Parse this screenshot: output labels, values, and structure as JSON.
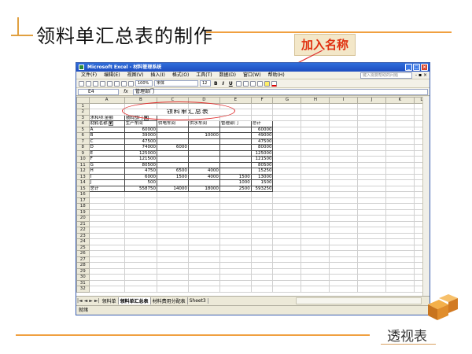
{
  "slide": {
    "title": "领料单汇总表的制作",
    "callout": "加入名称",
    "footer_label": "透视表",
    "accent_color": "#f0a040",
    "callout_text_color": "#e03010"
  },
  "excel": {
    "window_title": "Microsoft Excel - 材料管理系统",
    "menu": [
      "文件(F)",
      "编辑(E)",
      "视图(V)",
      "插入(I)",
      "格式(O)",
      "工具(T)",
      "数据(D)",
      "窗口(W)",
      "帮助(H)"
    ],
    "help_placeholder": "键入需要帮助的问题",
    "toolbar": {
      "zoom": "100%",
      "font": "宋体",
      "font_size": "12",
      "bold": "B",
      "italic": "I",
      "underline": "U"
    },
    "name_box": "E4",
    "fx": "fx",
    "formula": "管理部门",
    "columns": [
      "A",
      "B",
      "C",
      "D",
      "E",
      "F",
      "G",
      "H",
      "I",
      "J",
      "K",
      "L"
    ],
    "pivot": {
      "title": "领料单汇总表",
      "sum_label": "求和项:金额",
      "page_field": "领料部门",
      "header": [
        "材料名称",
        "生产车间",
        "供电车间",
        "供水车间",
        "管理部门",
        "总计"
      ],
      "rows": [
        [
          "A",
          "60000",
          "",
          "",
          "",
          "60000"
        ],
        [
          "B",
          "39000",
          "",
          "10000",
          "",
          "49000"
        ],
        [
          "C",
          "47500",
          "",
          "",
          "",
          "47500"
        ],
        [
          "D",
          "74000",
          "6000",
          "",
          "",
          "80000"
        ],
        [
          "E",
          "125000",
          "",
          "",
          "",
          "125000"
        ],
        [
          "F",
          "121500",
          "",
          "",
          "",
          "121500"
        ],
        [
          "G",
          "80500",
          "",
          "",
          "",
          "80500"
        ],
        [
          "H",
          "4750",
          "6500",
          "4000",
          "",
          "15250"
        ],
        [
          "I",
          "6000",
          "1500",
          "4000",
          "1500",
          "13000"
        ],
        [
          "J",
          "500",
          "",
          "",
          "1000",
          "1500"
        ],
        [
          "总计",
          "558750",
          "14000",
          "18000",
          "2500",
          "593250"
        ]
      ]
    },
    "row_numbers": [
      "1",
      "2",
      "3",
      "4",
      "5",
      "6",
      "7",
      "8",
      "9",
      "10",
      "11",
      "12",
      "13",
      "14",
      "15",
      "16",
      "17",
      "18",
      "19",
      "20",
      "21",
      "22",
      "23",
      "24",
      "25",
      "26",
      "27",
      "28",
      "29",
      "30",
      "31",
      "32"
    ],
    "sheet_tabs": [
      "领料单",
      "领料单汇总表",
      "材料费用分配表",
      "Sheet3"
    ],
    "active_tab": "领料单汇总表",
    "status": "就绪"
  }
}
